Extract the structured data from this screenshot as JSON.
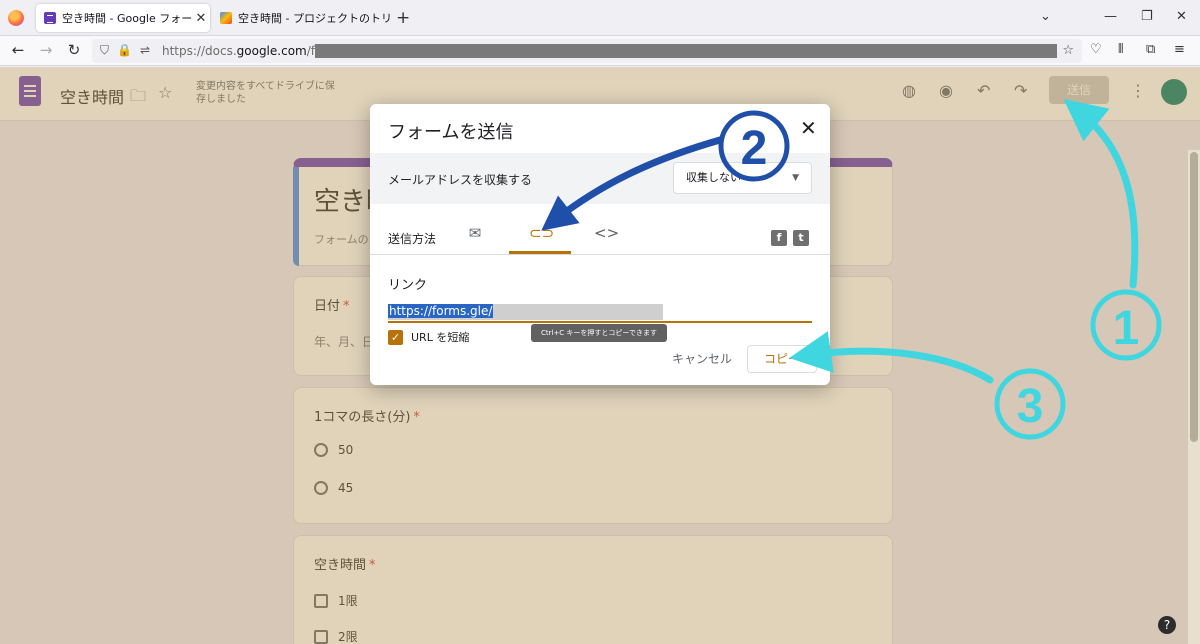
{
  "browser": {
    "tabs": [
      {
        "title": "空き時間 - Google フォーム",
        "active": true
      },
      {
        "title": "空き時間 - プロジェクトのトリガー - A",
        "active": false
      }
    ],
    "url_prefix": "https://docs.",
    "url_domain": "google.com",
    "url_path": "/forms/"
  },
  "forms_header": {
    "doc_title": "空き時間",
    "save_status": "変更内容をすべてドライブに保存しました",
    "send_label": "送信"
  },
  "form": {
    "title": "空き時",
    "description": "フォームの",
    "questions": [
      {
        "title": "日付",
        "required_mark": "*",
        "hint": "年、月、日"
      },
      {
        "title": "1コマの長さ(分)",
        "required_mark": "*",
        "options": [
          "50",
          "45"
        ]
      },
      {
        "title": "空き時間",
        "required_mark": "*",
        "options": [
          "1限",
          "2限"
        ]
      }
    ]
  },
  "dialog": {
    "title": "フォームを送信",
    "close": "✕",
    "collect_email_label": "メールアドレスを収集する",
    "collect_email_value": "収集しない",
    "send_method_label": "送信方法",
    "link_label": "リンク",
    "link_value": "https://forms.gle/",
    "shorten_label": "URL を短縮",
    "tooltip": "Ctrl+C キーを押すとコピーできます",
    "cancel_label": "キャンセル",
    "copy_label": "コピー"
  },
  "annotations": {
    "step1": "①",
    "step2": "②",
    "step3": "③",
    "colors": {
      "cyan": "#3fd6e0",
      "blue": "#1f4fa8"
    }
  },
  "colors": {
    "accent": "#b7730a",
    "forms_purple": "#673ab7"
  }
}
